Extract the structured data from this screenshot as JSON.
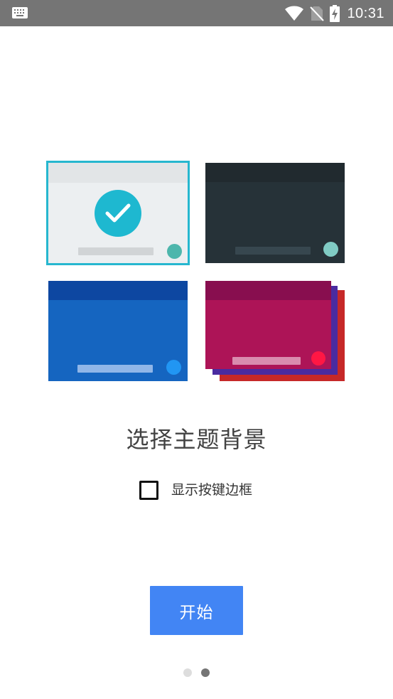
{
  "status_bar": {
    "time": "10:31",
    "icons": [
      "keyboard-icon",
      "wifi-icon",
      "no-sim-icon",
      "battery-charging-icon"
    ]
  },
  "themes": [
    {
      "name": "light",
      "selected": true,
      "colors": {
        "body": "#eceff1",
        "header": "#e2e5e7",
        "accent": "#4db6ac",
        "border": "#26b7cf"
      }
    },
    {
      "name": "dark",
      "selected": false,
      "colors": {
        "body": "#263238",
        "header": "#212a2f",
        "accent": "#80cbc4"
      }
    },
    {
      "name": "blue",
      "selected": false,
      "colors": {
        "body": "#1565c0",
        "header": "#0d47a1",
        "accent": "#2196f3"
      }
    },
    {
      "name": "gradient",
      "selected": false,
      "colors": {
        "body": "#ad1457",
        "header": "#880e4f",
        "accent": "#ff1744",
        "layers": [
          "#4a2ba0",
          "#c62828"
        ]
      }
    }
  ],
  "title": "选择主题背景",
  "option": {
    "label": "显示按键边框",
    "checked": false
  },
  "start_button": {
    "label": "开始",
    "color": "#4285f4"
  },
  "pager": {
    "total": 2,
    "current": 2
  }
}
